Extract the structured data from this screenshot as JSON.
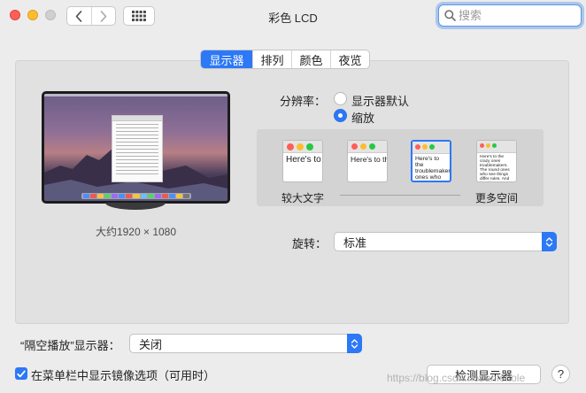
{
  "window": {
    "title": "彩色 LCD"
  },
  "search": {
    "placeholder": "搜索"
  },
  "tabs": [
    {
      "label": "显示器",
      "active": true
    },
    {
      "label": "排列",
      "active": false
    },
    {
      "label": "颜色",
      "active": false
    },
    {
      "label": "夜览",
      "active": false
    }
  ],
  "display": {
    "resolution_caption": "大约1920 × 1080"
  },
  "resolution": {
    "label": "分辨率：",
    "options": [
      {
        "label": "显示器默认",
        "selected": false
      },
      {
        "label": "缩放",
        "selected": true
      }
    ]
  },
  "scaling": {
    "thumbnails": [
      {
        "text": "Here's to the troublemakers. ones who see"
      },
      {
        "text": "Here's to the troublemakers. ones who see"
      },
      {
        "text": "Here's to the troublemakers. ones who see rules. And they"
      },
      {
        "text": "Here's to the crazy ones troublemakers. The round ones who see things differ rules. And they have no respect we can quote them, disagree Because they change things."
      }
    ],
    "selected_index": 2,
    "min_label": "较大文字",
    "max_label": "更多空间"
  },
  "rotation": {
    "label": "旋转：",
    "value": "标准"
  },
  "airplay": {
    "label": "“隔空播放”显示器：",
    "value": "关闭"
  },
  "mirror_option": {
    "label": "在菜单栏中显示镜像选项（可用时）",
    "checked": true
  },
  "detect_button": {
    "label": "检测显示器"
  },
  "help": {
    "label": "?"
  },
  "watermark": {
    "text": "https://blog.csdn.net/anlenole"
  },
  "colors": {
    "accent": "#2c78f6",
    "close": "#fe5f57",
    "minimize": "#febc2e"
  }
}
